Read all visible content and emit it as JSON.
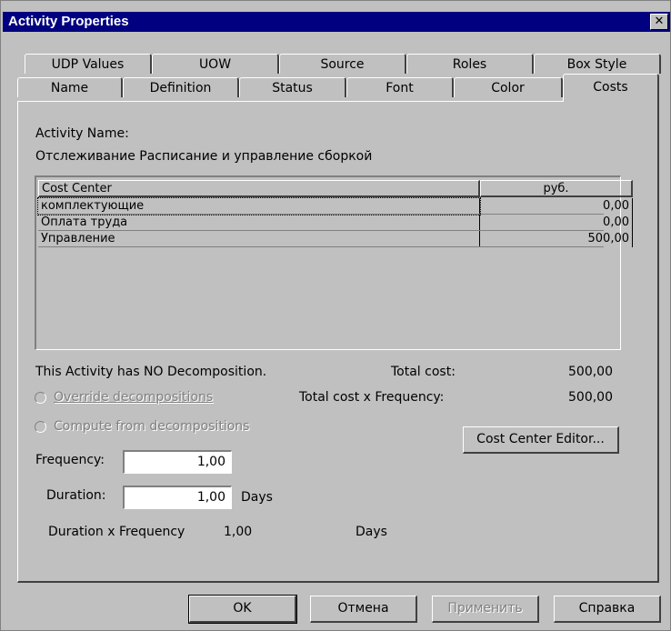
{
  "window": {
    "title": "Activity Properties",
    "close_glyph": "✕"
  },
  "tabs_row1": [
    "UDP Values",
    "UOW",
    "Source",
    "Roles",
    "Box Style"
  ],
  "tabs_row2": [
    "Name",
    "Definition",
    "Status",
    "Font",
    "Color",
    "Costs"
  ],
  "activity": {
    "name_label": "Activity Name:",
    "name_value": "Отслеживание Расписание и управление сборкой"
  },
  "cost_table": {
    "headers": [
      "Cost Center",
      "руб."
    ],
    "rows": [
      {
        "name": "комплектующие",
        "value": "0,00"
      },
      {
        "name": "Оплата труда",
        "value": "0,00"
      },
      {
        "name": "Управление",
        "value": "500,00"
      }
    ]
  },
  "decomposition_text": "This Activity has NO Decomposition.",
  "total_cost_label": "Total cost:",
  "total_cost_value": "500,00",
  "total_freq_label": "Total cost x Frequency:",
  "total_freq_value": "500,00",
  "radios": {
    "override": "Override decompositions",
    "compute": "Compute from decompositions"
  },
  "cost_center_editor_button": "Cost Center Editor...",
  "frequency": {
    "label": "Frequency:",
    "value": "1,00"
  },
  "duration": {
    "label": "Duration:",
    "value": "1,00",
    "unit": "Days"
  },
  "duration_x_frequency": {
    "label": "Duration x Frequency",
    "value": "1,00",
    "unit": "Days"
  },
  "buttons": {
    "ok": "OK",
    "cancel": "Отмена",
    "apply": "Применить",
    "help": "Справка"
  }
}
